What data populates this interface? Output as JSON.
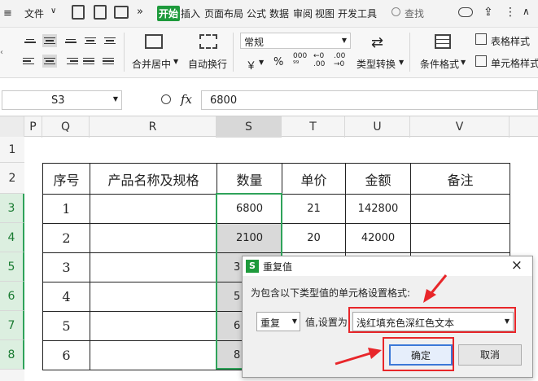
{
  "menu": {
    "file": "文件",
    "tabs": [
      "开始",
      "插入",
      "页面布局",
      "公式",
      "数据",
      "审阅",
      "视图",
      "开发工具"
    ],
    "search": "查找"
  },
  "ribbon": {
    "merge": "合并居中",
    "wrap": "自动换行",
    "number_format": "常规",
    "currency": "￥",
    "percent": "%",
    "type_convert": "类型转换",
    "cond_format": "条件格式",
    "table_style": "表格样式",
    "cell_style": "单元格样式"
  },
  "formula_bar": {
    "name_box": "S3",
    "fx": "fx",
    "value": "6800"
  },
  "columns": [
    "P",
    "Q",
    "R",
    "S",
    "T",
    "U",
    "V"
  ],
  "rows": [
    "1",
    "2",
    "3",
    "4",
    "5",
    "6",
    "7",
    "8"
  ],
  "table": {
    "headers": [
      "序号",
      "产品名称及规格",
      "数量",
      "单价",
      "金额",
      "备注"
    ],
    "rows": [
      {
        "seq": "1",
        "name": "",
        "qty": "6800",
        "price": "21",
        "amount": "142800",
        "note": ""
      },
      {
        "seq": "2",
        "name": "",
        "qty": "2100",
        "price": "20",
        "amount": "42000",
        "note": ""
      },
      {
        "seq": "3",
        "name": "",
        "qty": "3",
        "price": "",
        "amount": "",
        "note": ""
      },
      {
        "seq": "4",
        "name": "",
        "qty": "5",
        "price": "",
        "amount": "",
        "note": ""
      },
      {
        "seq": "5",
        "name": "",
        "qty": "6",
        "price": "",
        "amount": "",
        "note": ""
      },
      {
        "seq": "6",
        "name": "",
        "qty": "8",
        "price": "",
        "amount": "",
        "note": ""
      }
    ]
  },
  "dialog": {
    "title": "重复值",
    "close": "×",
    "description": "为包含以下类型值的单元格设置格式:",
    "type_value": "重复",
    "set_as_label": "值,设置为",
    "format_value": "浅红填充色深红色文本",
    "ok": "确定",
    "cancel": "取消"
  },
  "colors": {
    "accent": "#1e9a3c",
    "arrow": "#e8262a",
    "selection": "#2fa35a"
  }
}
